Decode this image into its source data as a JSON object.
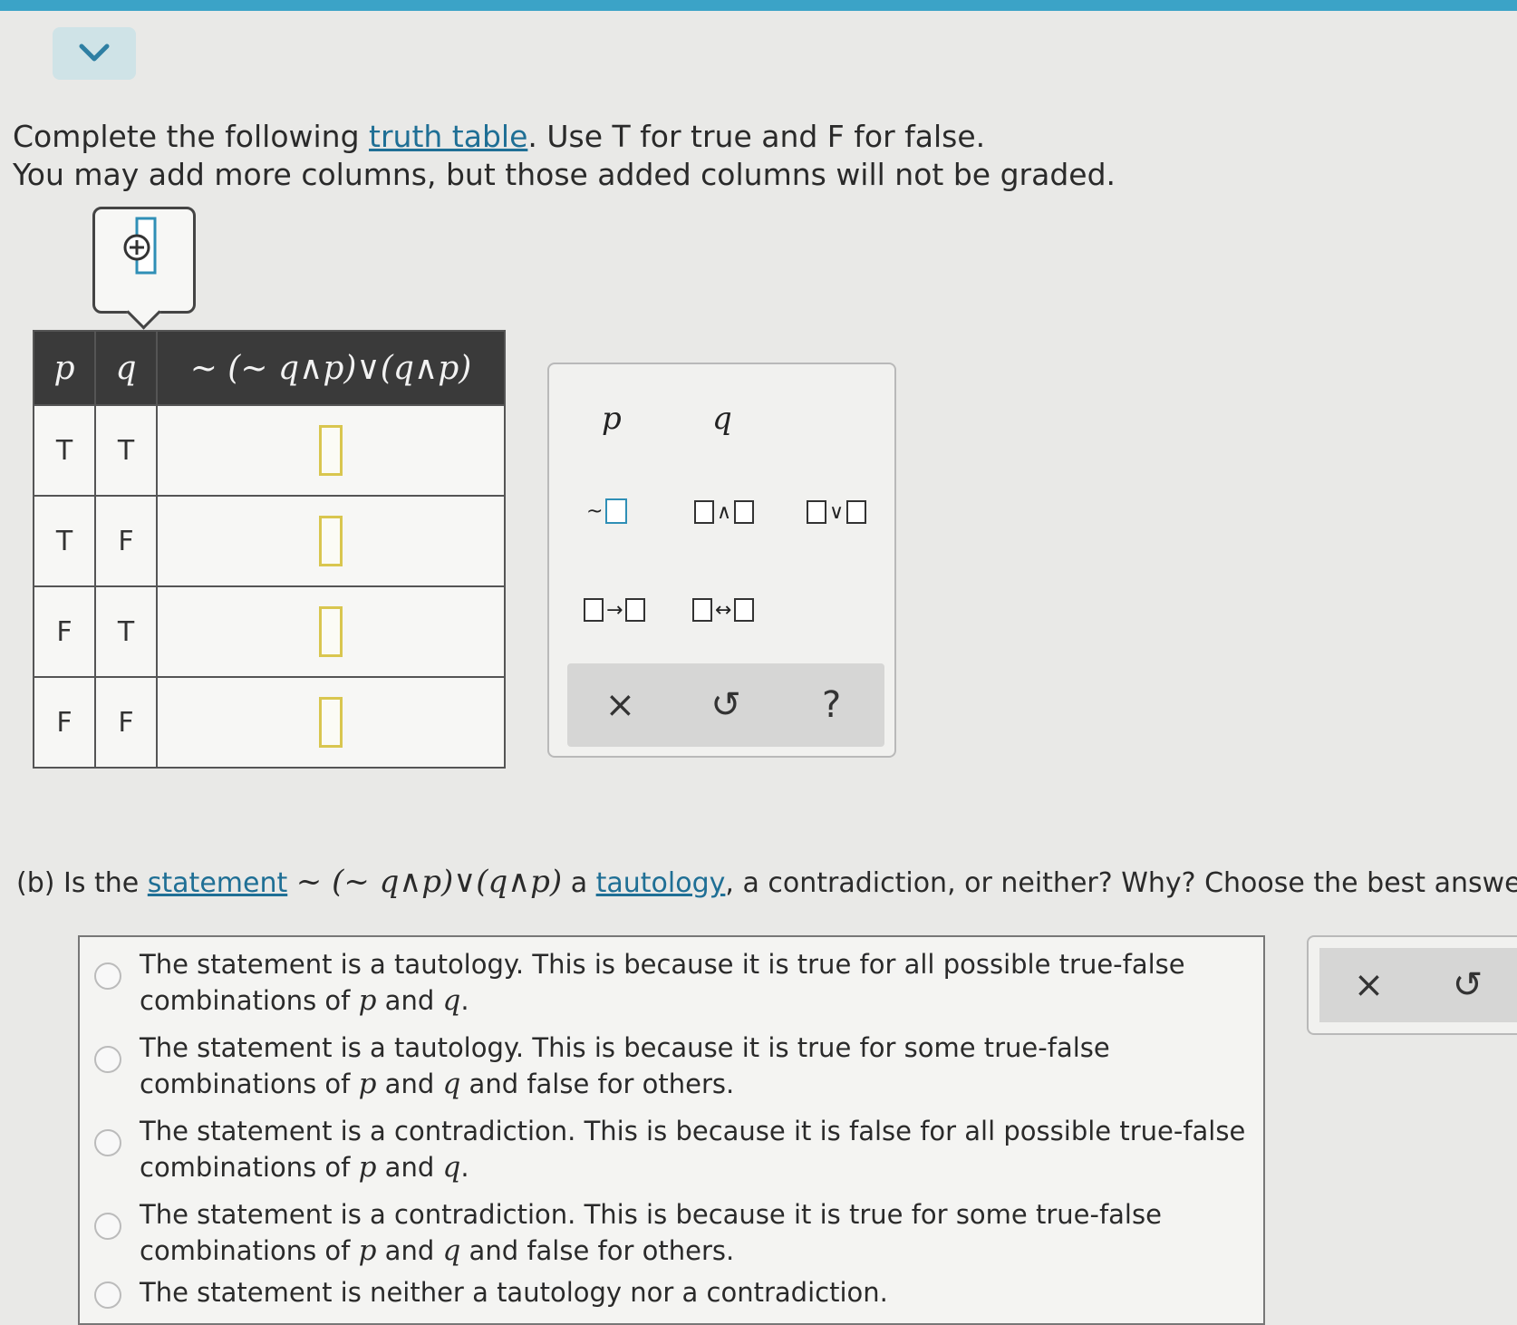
{
  "prompt": {
    "line1_before": "Complete the following ",
    "line1_link": "truth table",
    "line1_after": ". Use T for true and F for false.",
    "line2": "You may add more columns, but those added columns will not be graded."
  },
  "truth_table": {
    "headers": [
      "p",
      "q",
      "~ (~ q∧p)∨(q∧p)"
    ],
    "rows": [
      {
        "p": "T",
        "q": "T"
      },
      {
        "p": "T",
        "q": "F"
      },
      {
        "p": "F",
        "q": "T"
      },
      {
        "p": "F",
        "q": "F"
      }
    ]
  },
  "palette": {
    "vars": [
      "p",
      "q"
    ],
    "ops": {
      "not": "~",
      "and": "∧",
      "or": "∨",
      "implies": "→",
      "iff": "↔"
    },
    "actions": {
      "clear": "×",
      "undo": "↺",
      "help": "?"
    }
  },
  "question_b": {
    "prefix": "(b) Is the ",
    "link1": "statement",
    "expr": "~ (~ q∧p)∨(q∧p)",
    "mid": " a ",
    "link2": "tautology",
    "suffix": ", a contradiction, or neither? Why? Choose the best answer."
  },
  "options": [
    {
      "l1": "The statement is a tautology. This is because it is true for all possible true-false",
      "l2a": "combinations of ",
      "p": "p",
      "and": " and ",
      "q": "q",
      "l2b": "."
    },
    {
      "l1": "The statement is a tautology. This is because it is true for some true-false",
      "l2a": "combinations of ",
      "p": "p",
      "and": " and ",
      "q": "q",
      "l2b": " and false for others."
    },
    {
      "l1": "The statement is a contradiction. This is because it is false for all possible true-false",
      "l2a": "combinations of ",
      "p": "p",
      "and": " and ",
      "q": "q",
      "l2b": "."
    },
    {
      "l1": "The statement is a contradiction. This is because it is true for some true-false",
      "l2a": "combinations of ",
      "p": "p",
      "and": " and ",
      "q": "q",
      "l2b": " and false for others."
    },
    {
      "l1": "The statement is neither a tautology nor a contradiction."
    }
  ],
  "side_actions": {
    "clear": "×",
    "undo": "↺"
  }
}
